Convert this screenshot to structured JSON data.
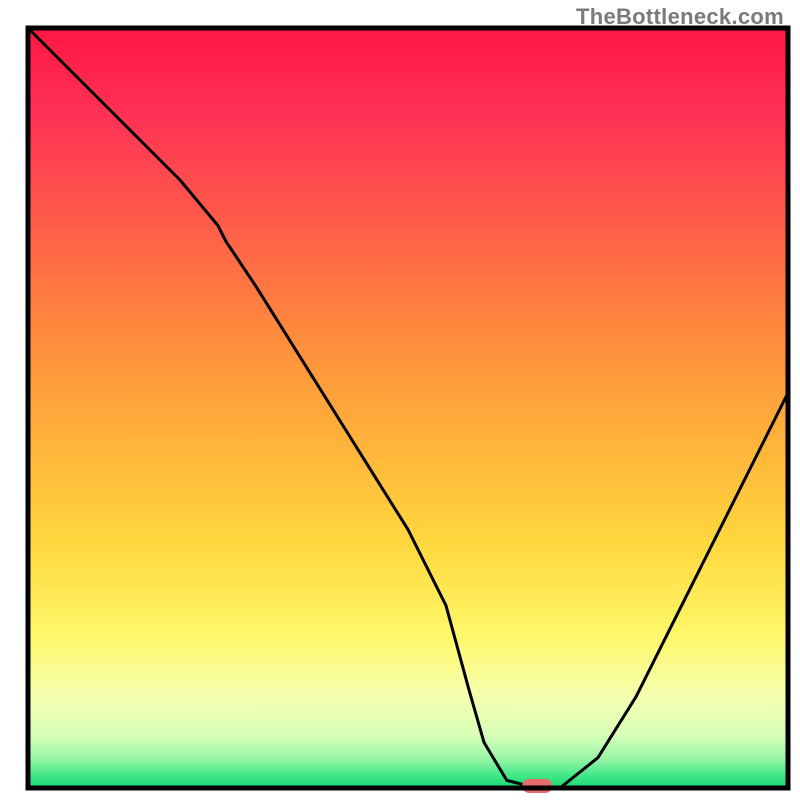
{
  "watermark": "TheBottleneck.com",
  "chart_data": {
    "type": "line",
    "x_range": [
      0,
      100
    ],
    "y_range": [
      0,
      100
    ],
    "x": [
      0,
      5,
      10,
      15,
      20,
      25,
      26,
      30,
      35,
      40,
      45,
      50,
      55,
      58,
      60,
      63,
      67,
      70,
      75,
      80,
      85,
      90,
      95,
      100
    ],
    "values": [
      100,
      95,
      90,
      85,
      80,
      74,
      72,
      66,
      58,
      50,
      42,
      34,
      24,
      13,
      6,
      1,
      0,
      0,
      4,
      12,
      22,
      32,
      42,
      52
    ],
    "marker": {
      "x": 67,
      "y": 0,
      "color": "#e66b6b"
    },
    "title": "",
    "xlabel": "",
    "ylabel": "",
    "ylim": [
      0,
      100
    ],
    "background_gradient": {
      "stops": [
        {
          "offset": 0.0,
          "color": "#ff1744"
        },
        {
          "offset": 0.12,
          "color": "#ff3355"
        },
        {
          "offset": 0.25,
          "color": "#ff5a4a"
        },
        {
          "offset": 0.4,
          "color": "#ff8a3d"
        },
        {
          "offset": 0.55,
          "color": "#ffb43a"
        },
        {
          "offset": 0.68,
          "color": "#ffd83e"
        },
        {
          "offset": 0.8,
          "color": "#fff86b"
        },
        {
          "offset": 0.88,
          "color": "#f5ffb0"
        },
        {
          "offset": 0.93,
          "color": "#d8ffb8"
        },
        {
          "offset": 0.96,
          "color": "#9cf7a8"
        },
        {
          "offset": 0.985,
          "color": "#3ee686"
        },
        {
          "offset": 1.0,
          "color": "#18d873"
        }
      ]
    },
    "border_color": "#000000",
    "curve_color": "#000000"
  }
}
